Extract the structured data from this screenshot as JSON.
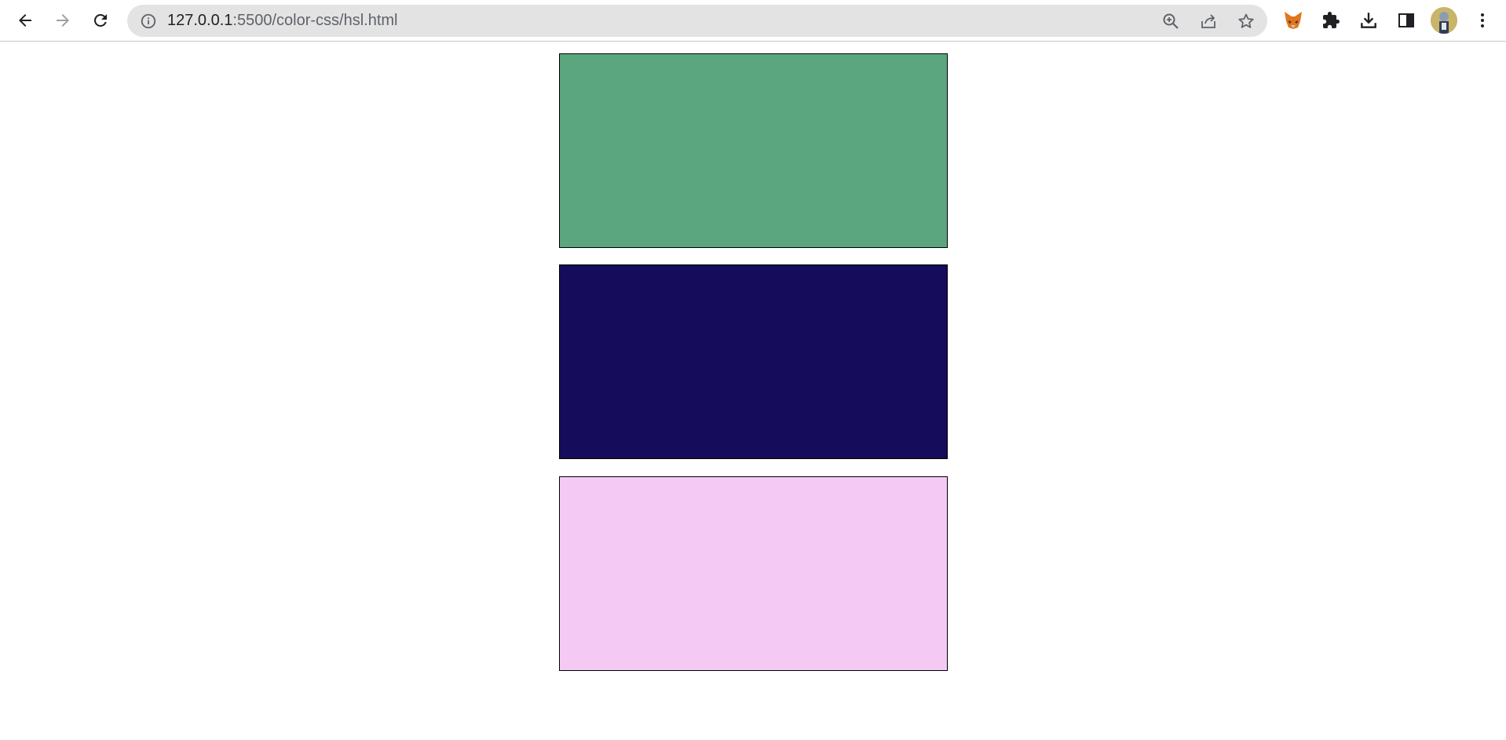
{
  "browser": {
    "url_host": "127.0.0.1",
    "url_rest": ":5500/color-css/hsl.html",
    "icons": {
      "back": "back-arrow-icon",
      "forward": "forward-arrow-icon",
      "reload": "reload-icon",
      "site_info": "info-icon",
      "zoom": "zoom-icon",
      "share": "share-icon",
      "bookmark": "star-icon",
      "extension_fox": "fox-extension-icon",
      "extensions": "puzzle-icon",
      "downloads": "download-icon",
      "side_panel": "side-panel-icon",
      "profile": "avatar",
      "menu": "kebab-menu-icon"
    }
  },
  "page": {
    "boxes": [
      {
        "name": "green-box",
        "color": "#5ba67e"
      },
      {
        "name": "navy-box",
        "color": "#150c5b"
      },
      {
        "name": "pink-box",
        "color": "#f4caf5"
      }
    ]
  }
}
